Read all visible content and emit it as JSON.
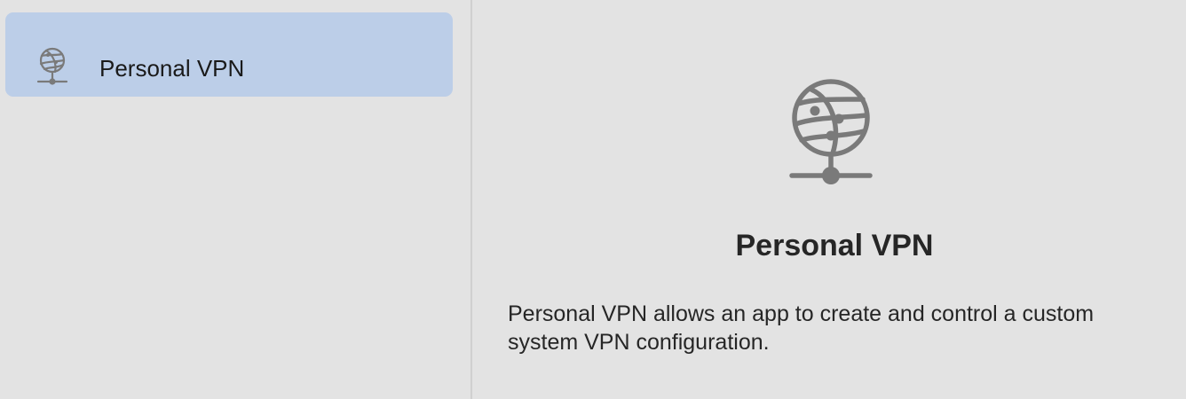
{
  "sidebar": {
    "items": [
      {
        "label": "Personal VPN",
        "icon": "globe-network-icon",
        "selected": true
      }
    ]
  },
  "detail": {
    "icon": "globe-network-icon",
    "title": "Personal VPN",
    "description": "Personal VPN allows an app to create and control a custom system VPN configuration."
  },
  "colors": {
    "background": "#e3e3e3",
    "selection": "#bccee8",
    "icon": "#7a7a7a",
    "text": "#262626",
    "divider": "#d0d0d0"
  }
}
